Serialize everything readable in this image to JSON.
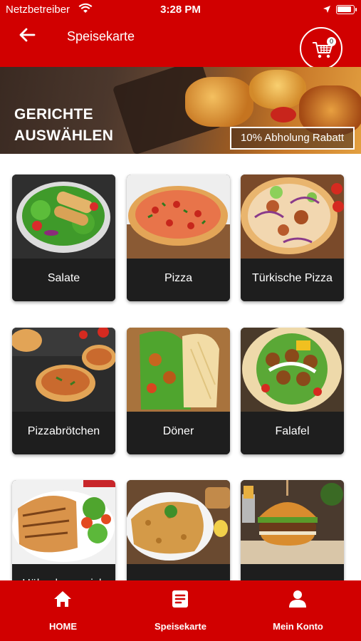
{
  "status_bar": {
    "carrier": "Netzbetreiber",
    "time": "3:28 PM"
  },
  "header": {
    "title": "Speisekarte",
    "cart_count": "0"
  },
  "banner": {
    "heading_line1": "GERICHTE",
    "heading_line2": "AUSWÄHLEN",
    "badge": "10% Abholung Rabatt"
  },
  "categories": [
    {
      "label": "Salate",
      "icon": "salad-image"
    },
    {
      "label": "Pizza",
      "icon": "pizza-image"
    },
    {
      "label": "Türkische Pizza",
      "icon": "turkish-pizza-image"
    },
    {
      "label": "Pizzabrötchen",
      "icon": "pizza-rolls-image"
    },
    {
      "label": "Döner",
      "icon": "doner-image"
    },
    {
      "label": "Falafel",
      "icon": "falafel-image"
    },
    {
      "label": "Hähnchengerich",
      "icon": "chicken-dish-image"
    },
    {
      "label": "",
      "icon": "schnitzel-image"
    },
    {
      "label": "",
      "icon": "burger-image"
    }
  ],
  "bottom_nav": [
    {
      "label": "HOME",
      "icon": "home-icon"
    },
    {
      "label": "Speisekarte",
      "icon": "menu-icon"
    },
    {
      "label": "Mein Konto",
      "icon": "account-icon"
    }
  ],
  "colors": {
    "primary": "#d10000",
    "card_label_bg": "#1e1e1e",
    "text_light": "#ffffff"
  }
}
